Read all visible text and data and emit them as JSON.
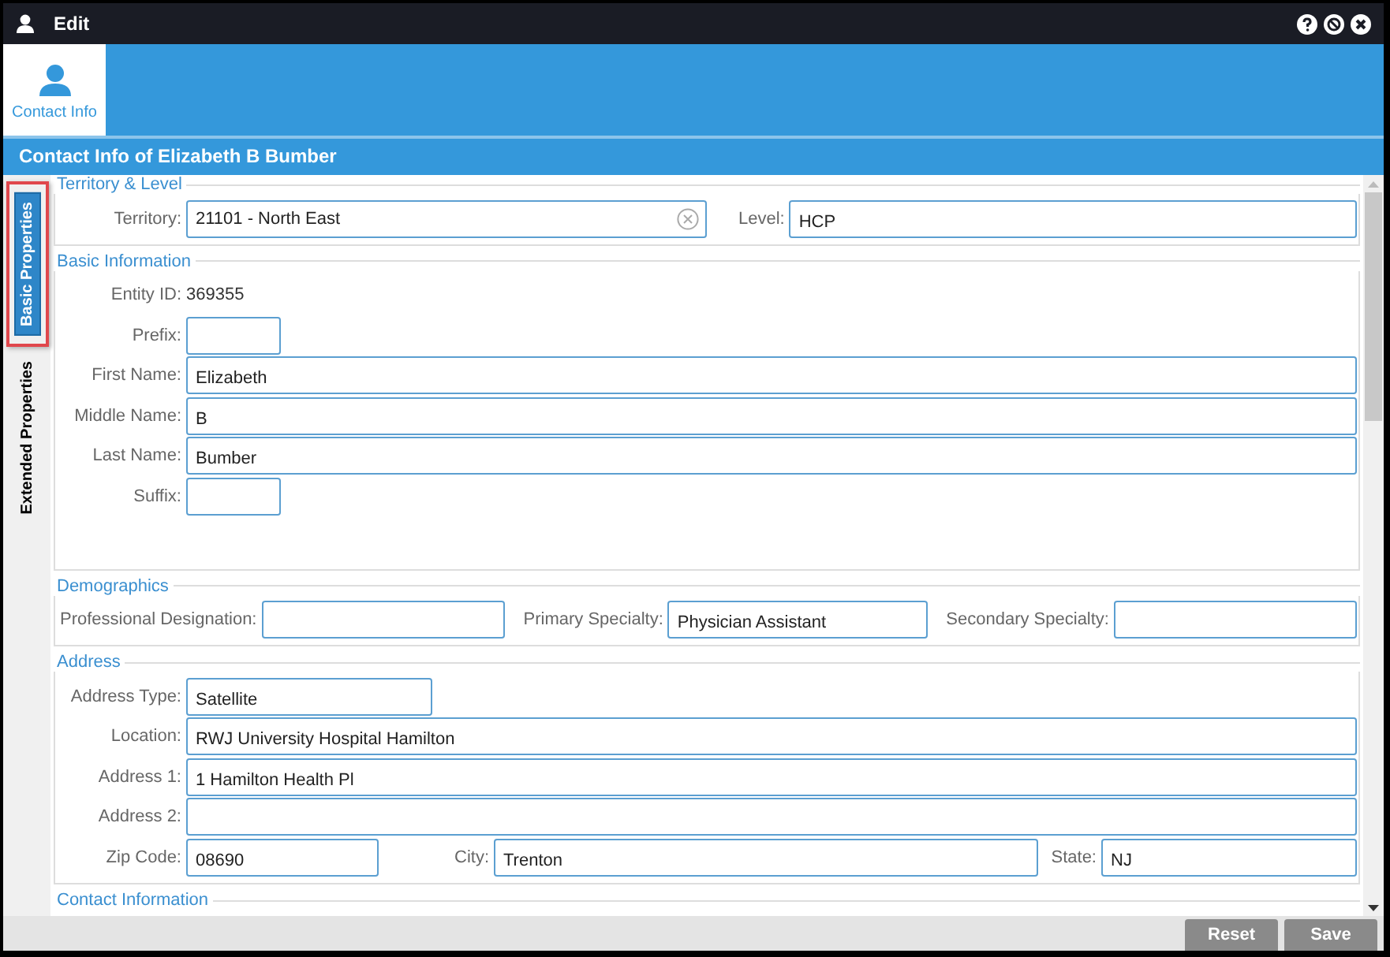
{
  "window": {
    "title": "Edit"
  },
  "top_tabs": [
    {
      "label": "Contact Info",
      "selected": true
    }
  ],
  "header": "Contact Info of Elizabeth B Bumber",
  "side_tabs": [
    {
      "label": "Basic Properties",
      "selected": true,
      "highlighted": true
    },
    {
      "label": "Extended Properties",
      "selected": false,
      "highlighted": false
    }
  ],
  "sections": [
    {
      "title": "Territory & Level",
      "rows": [
        [
          {
            "label": "Territory:",
            "value": "21101 - North East",
            "kind": "clearable"
          },
          {
            "label": "Level:",
            "value": "HCP",
            "kind": "text"
          }
        ]
      ]
    },
    {
      "title": "Basic Information",
      "rows": [
        [
          {
            "label": "Entity ID:",
            "value": "369355",
            "kind": "static"
          }
        ],
        [
          {
            "label": "Prefix:",
            "kind": "short"
          }
        ],
        [
          {
            "label": "First Name:",
            "value": "Elizabeth",
            "kind": "text"
          }
        ],
        [
          {
            "label": "Middle Name:",
            "value": "B",
            "kind": "text"
          }
        ],
        [
          {
            "label": "Last Name:",
            "value": "Bumber",
            "kind": "text"
          }
        ],
        [
          {
            "label": "Suffix:",
            "kind": "short"
          }
        ]
      ]
    },
    {
      "title": "Demographics",
      "rows": [
        [
          {
            "label": "Professional Designation:",
            "kind": "text"
          },
          {
            "label": "Primary Specialty:",
            "value": "Physician Assistant",
            "kind": "text"
          },
          {
            "label": "Secondary Specialty:",
            "kind": "text"
          }
        ]
      ]
    },
    {
      "title": "Address",
      "rows": [
        [
          {
            "label": "Address Type:",
            "value": "Satellite",
            "kind": "medium"
          }
        ],
        [
          {
            "label": "Location:",
            "value": "RWJ University Hospital Hamilton",
            "kind": "text"
          }
        ],
        [
          {
            "label": "Address 1:",
            "value": "1 Hamilton Health Pl",
            "kind": "text"
          }
        ],
        [
          {
            "label": "Address 2:",
            "kind": "text"
          }
        ],
        [
          {
            "label": "Zip Code:",
            "value": "08690",
            "kind": "medium"
          },
          {
            "label": "City:",
            "value": "Trenton",
            "kind": "text"
          },
          {
            "label": "State:",
            "value": "NJ",
            "kind": "state"
          }
        ]
      ]
    },
    {
      "title": "Contact Information"
    }
  ],
  "buttons": [
    "Reset",
    "Save"
  ]
}
